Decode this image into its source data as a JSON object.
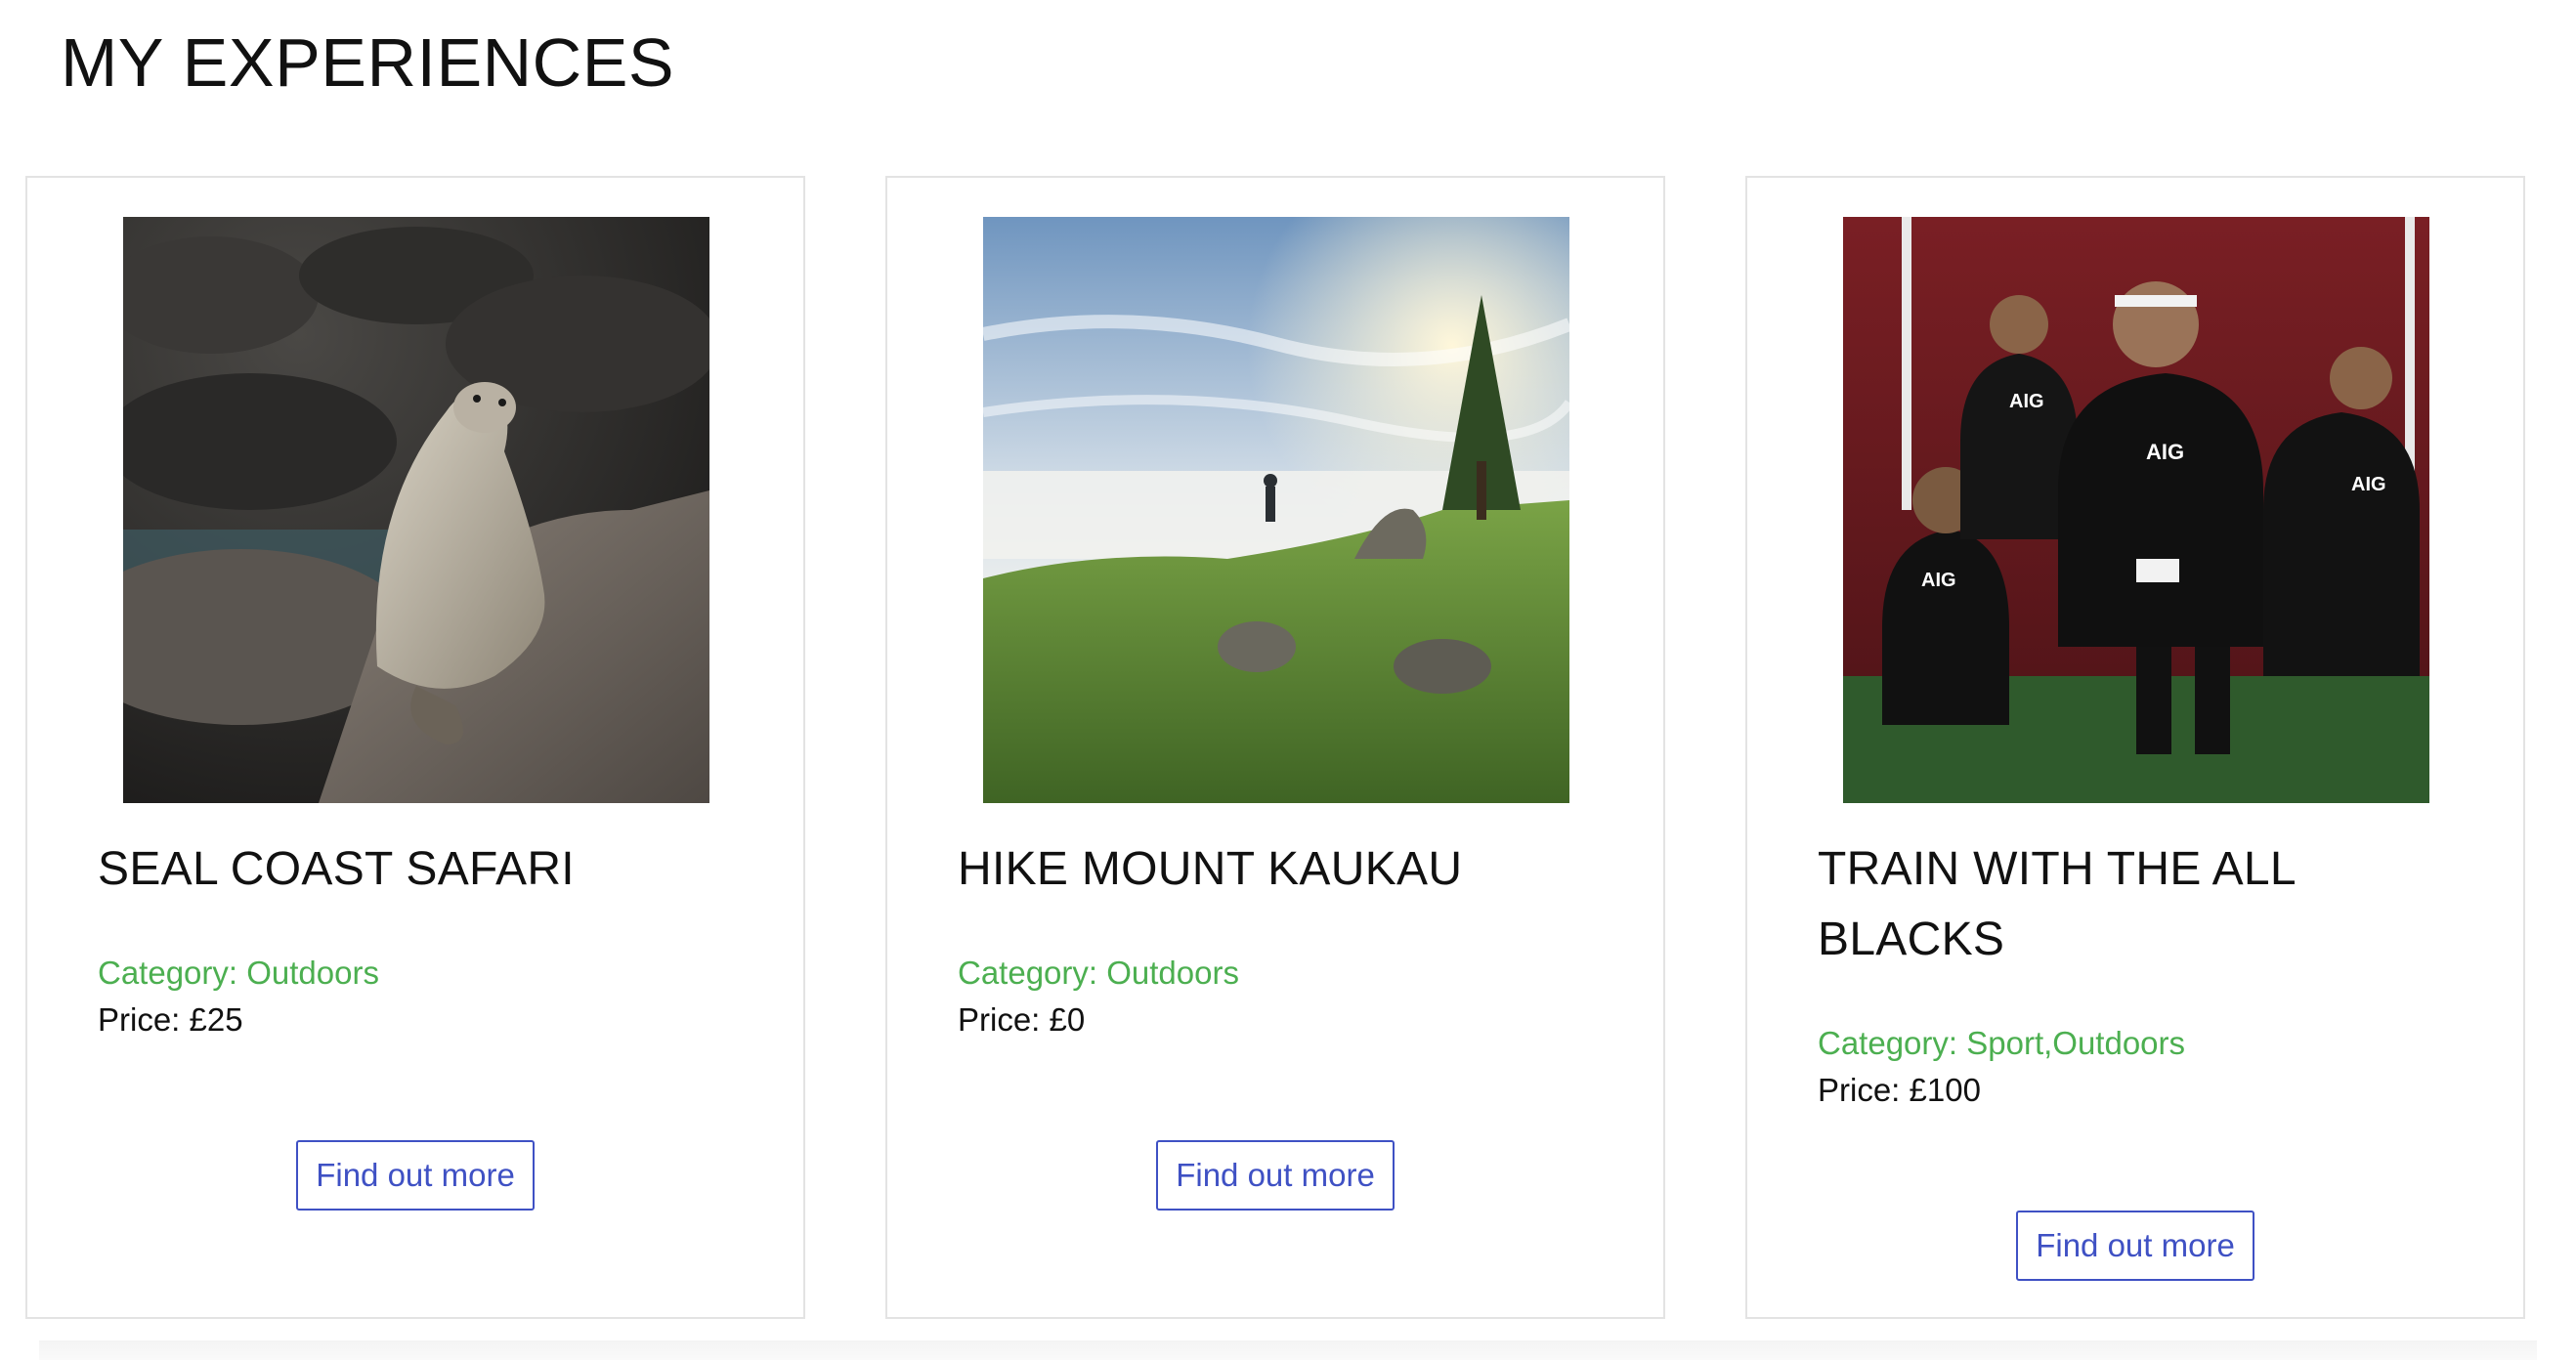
{
  "page": {
    "title": "MY EXPERIENCES"
  },
  "experiences": [
    {
      "title": "SEAL COAST SAFARI",
      "category": "Category: Outdoors",
      "price": "Price: £25",
      "button_label": "Find out more",
      "image_alt": "Seal on coastal rocks"
    },
    {
      "title": "HIKE MOUNT KAUKAU",
      "category": "Category: Outdoors",
      "price": "Price: £0",
      "button_label": "Find out more",
      "image_alt": "Hiker on a hilltop above the clouds"
    },
    {
      "title": "TRAIN WITH THE ALL BLACKS",
      "category": "Category: Sport,Outdoors",
      "price": "Price: £100",
      "button_label": "Find out more",
      "image_alt": "All Blacks rugby players performing the haka"
    }
  ],
  "colors": {
    "category": "#4caf50",
    "button": "#3f51c4",
    "card_border": "#e3e3e3"
  }
}
